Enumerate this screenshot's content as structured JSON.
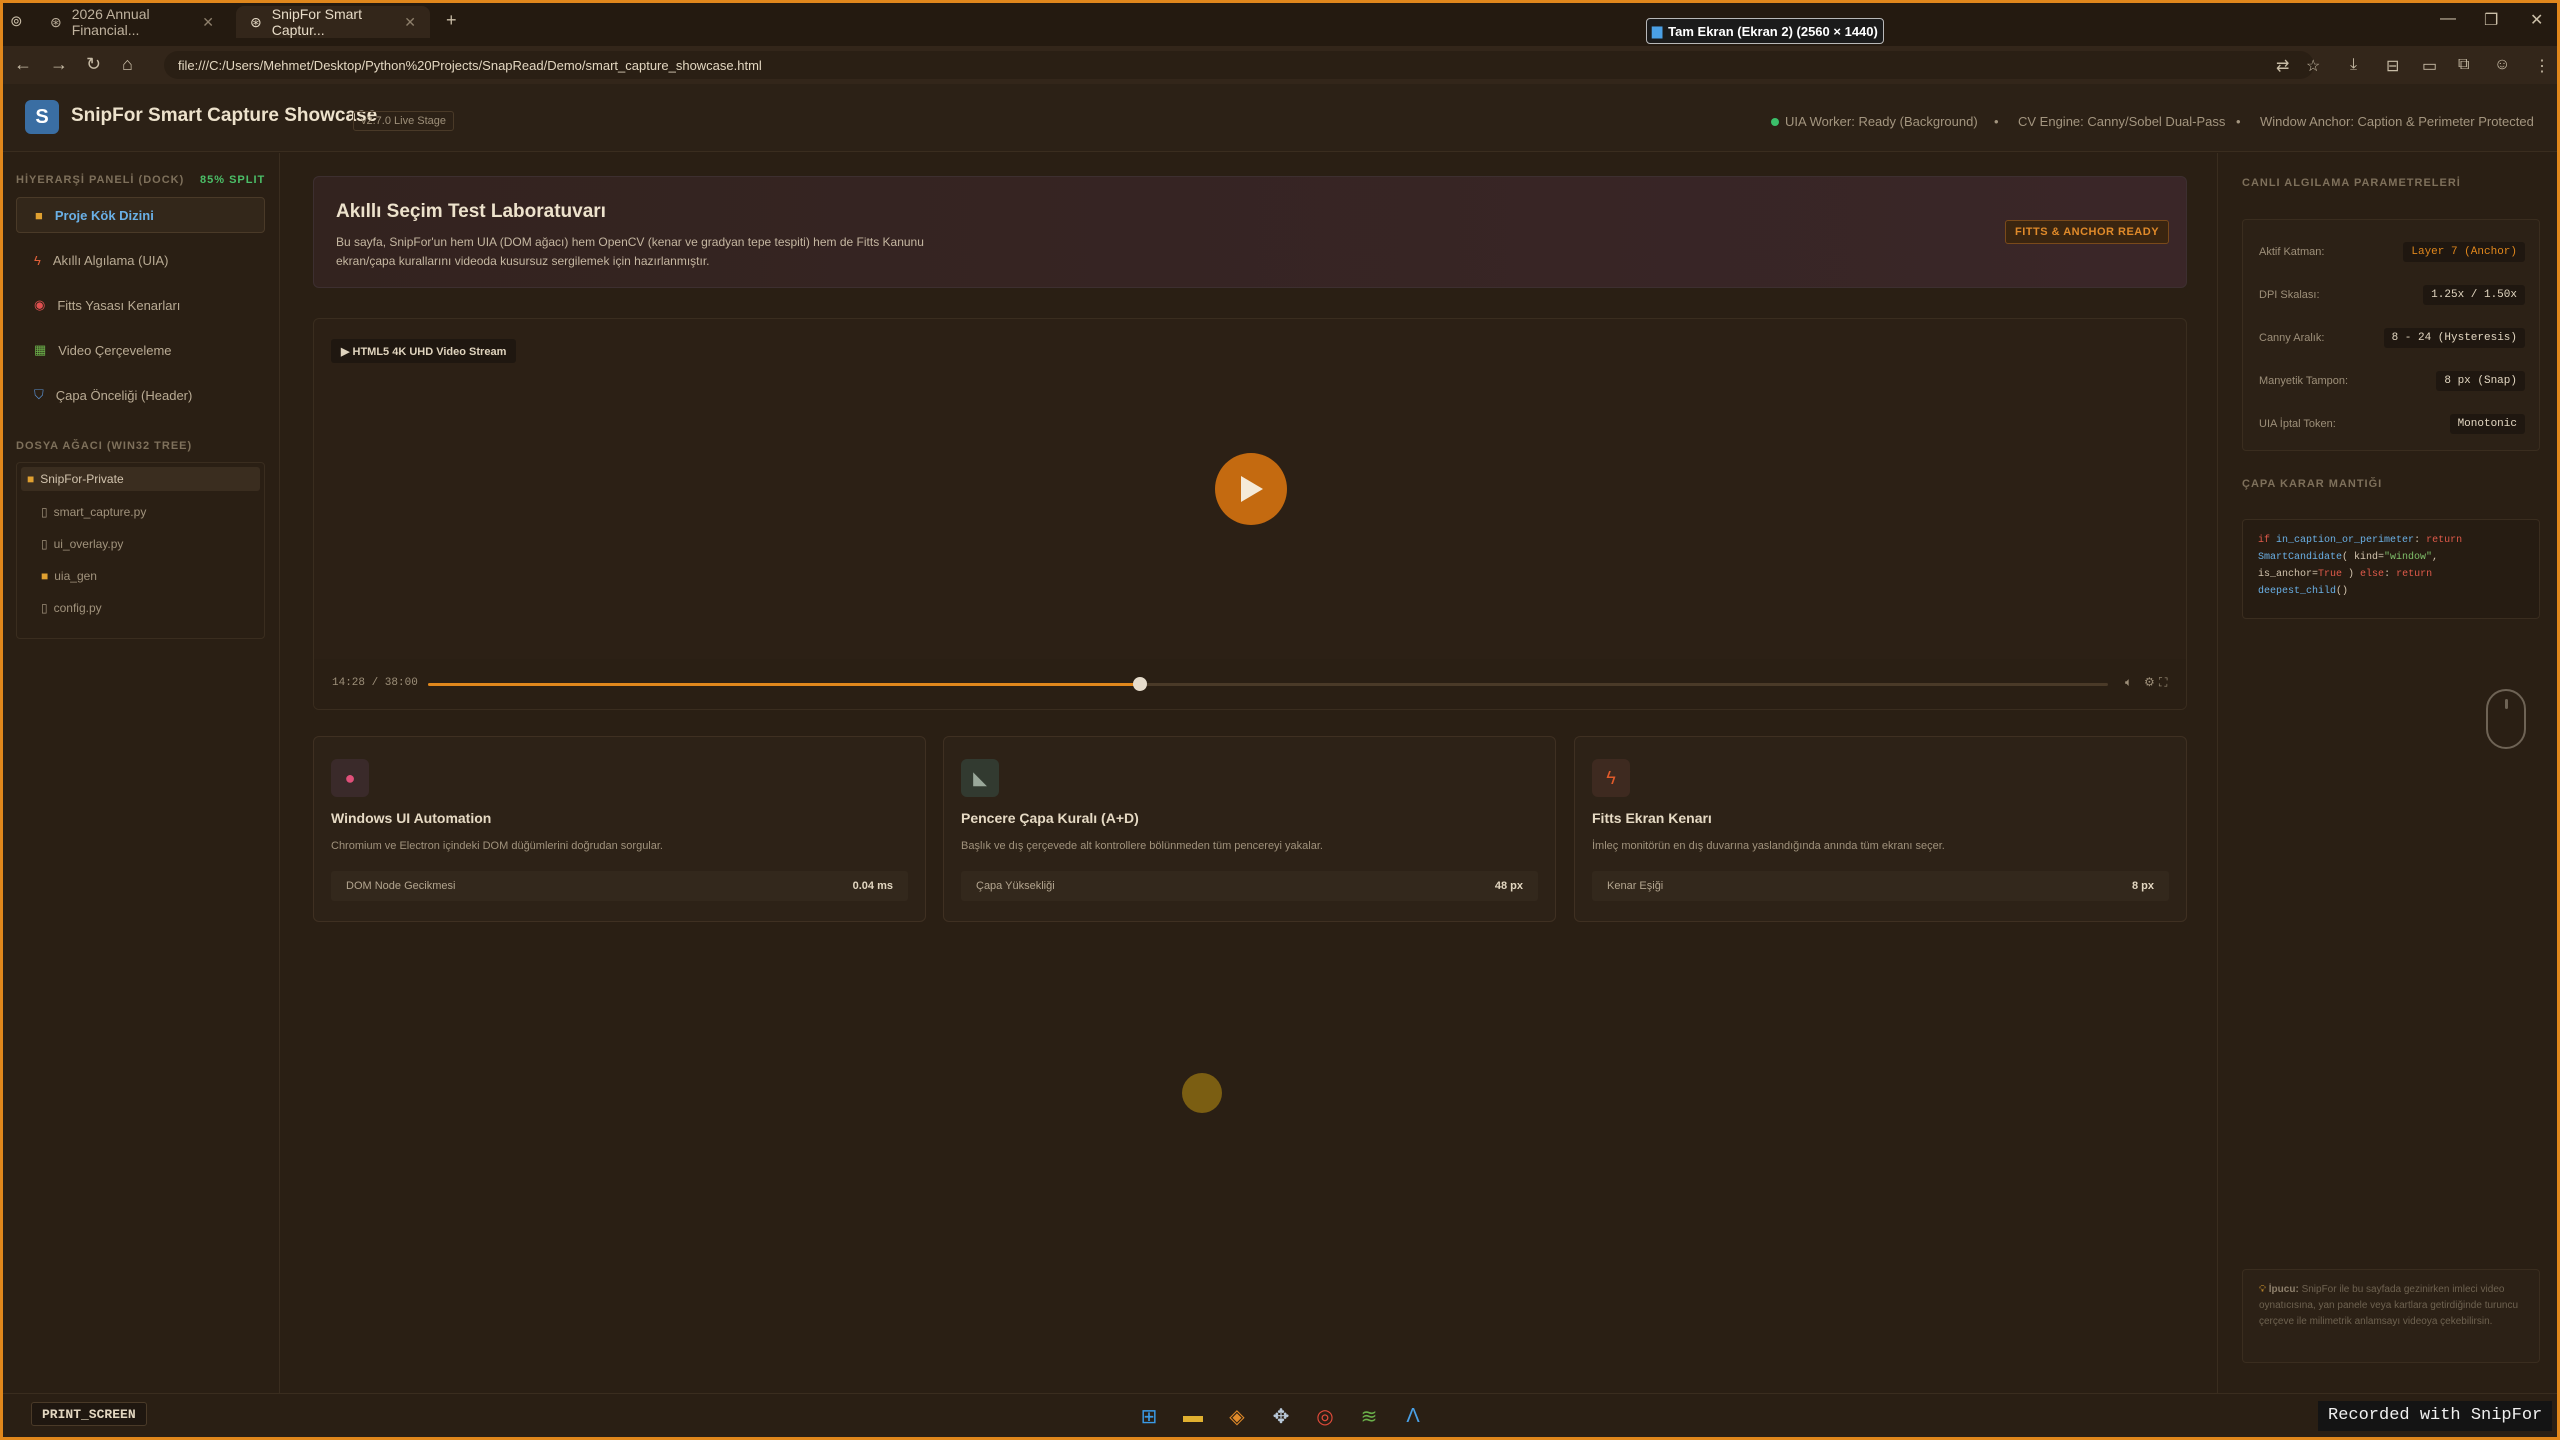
{
  "browser": {
    "tabs": [
      {
        "label": "2026 Annual Financial..."
      },
      {
        "label": "SnipFor Smart Captur..."
      }
    ],
    "url": "file:///C:/Users/Mehmet/Desktop/Python%20Projects/SnapRead/Demo/smart_capture_showcase.html",
    "screen_badge": "Tam Ekran (Ekran 2) (2560 × 1440)"
  },
  "app": {
    "logo_letter": "S",
    "title": "SnipFor Smart Capture Showcase",
    "version": "v2.7.0 Live Stage",
    "status_worker": "UIA Worker: Ready (Background)",
    "status_cv": "CV Engine: Canny/Sobel Dual-Pass",
    "status_anchor": "Window Anchor: Caption & Perimeter Protected"
  },
  "sidebar": {
    "header": "HİYERARŞİ PANELİ (DOCK)",
    "split": "85% SPLIT",
    "items": [
      {
        "label": "Proje Kök Dizini",
        "icon": "folder-icon"
      },
      {
        "label": "Akıllı Algılama (UIA)",
        "icon": "bolt-icon"
      },
      {
        "label": "Fitts Yasası Kenarları",
        "icon": "target-icon"
      },
      {
        "label": "Video Çerçeveleme",
        "icon": "image-icon"
      },
      {
        "label": "Çapa Önceliği (Header)",
        "icon": "shield-icon"
      }
    ],
    "tree_header": "DOSYA AĞACI (WIN32 TREE)",
    "tree": [
      {
        "label": "SnipFor-Private",
        "type": "folder"
      },
      {
        "label": "smart_capture.py",
        "type": "file"
      },
      {
        "label": "ui_overlay.py",
        "type": "file"
      },
      {
        "label": "uia_gen",
        "type": "folder"
      },
      {
        "label": "config.py",
        "type": "file"
      }
    ]
  },
  "banner": {
    "title": "Akıllı Seçim Test Laboratuvarı",
    "desc": "Bu sayfa, SnipFor'un hem UIA (DOM ağacı) hem OpenCV (kenar ve gradyan tepe tespiti) hem de Fitts Kanunu ekran/çapa kurallarını videoda kusursuz sergilemek için hazırlanmıştır.",
    "badge": "FITTS & ANCHOR READY"
  },
  "video": {
    "label": "▶ HTML5 4K UHD Video Stream",
    "time": "14:28 / 38:00",
    "progress": 0.4237
  },
  "cards": [
    {
      "title": "Windows UI Automation",
      "desc": "Chromium ve Electron içindeki DOM düğümlerini doğrudan sorgular.",
      "metric_label": "DOM Node Gecikmesi",
      "metric_value": "0.04 ms",
      "icon": "brain-icon",
      "accent": "#e0507a"
    },
    {
      "title": "Pencere Çapa Kuralı (A+D)",
      "desc": "Başlık ve dış çerçevede alt kontrollere bölünmeden tüm pencereyi yakalar.",
      "metric_label": "Çapa Yüksekliği",
      "metric_value": "48 px",
      "icon": "triangle-ruler-icon",
      "accent": "#9aa89a"
    },
    {
      "title": "Fitts Ekran Kenarı",
      "desc": "İmleç monitörün en dış duvarına yaslandığında anında tüm ekranı seçer.",
      "metric_label": "Kenar Eşiği",
      "metric_value": "8 px",
      "icon": "bolt-icon",
      "accent": "#e05a2a"
    }
  ],
  "right_panel": {
    "params_header": "CANLI ALGILAMA PARAMETRELERİ",
    "params": [
      {
        "label": "Aktif Katman:",
        "value": "Layer 7 (Anchor)"
      },
      {
        "label": "DPI Skalası:",
        "value": "1.25x / 1.50x"
      },
      {
        "label": "Canny Aralık:",
        "value": "8 - 24 (Hysteresis)"
      },
      {
        "label": "Manyetik Tampon:",
        "value": "8 px (Snap)"
      },
      {
        "label": "UIA İptal Token:",
        "value": "Monotonic"
      }
    ],
    "logic_header": "ÇAPA KARAR MANTIĞI",
    "code": {
      "l1_kw": "if",
      "l1_fn": "in_caption_or_perimeter",
      "l1_rest": ": ",
      "l1_ret": "return",
      "l2_fn": "SmartCandidate",
      "l2_rest": "( kind=",
      "l2_str": "\"window\"",
      "l2_end": ",",
      "l3_a": "is_anchor=",
      "l3_kw": "True",
      "l3_b": " ) ",
      "l3_else": "else",
      "l3_c": ": ",
      "l3_ret": "return",
      "l4_fn": "deepest_child",
      "l4_rest": "()"
    },
    "tip_label": "İpucu:",
    "tip": "SnipFor ile bu sayfada gezinirken imleci video oynatıcısına, yan panele veya kartlara getirdiğinde turuncu çerçeve ile milimetrik anlamsayı videoya çekebilirsin."
  },
  "taskbar": {
    "print_screen": "PRINT_SCREEN",
    "recorded": "Recorded with SnipFor"
  }
}
